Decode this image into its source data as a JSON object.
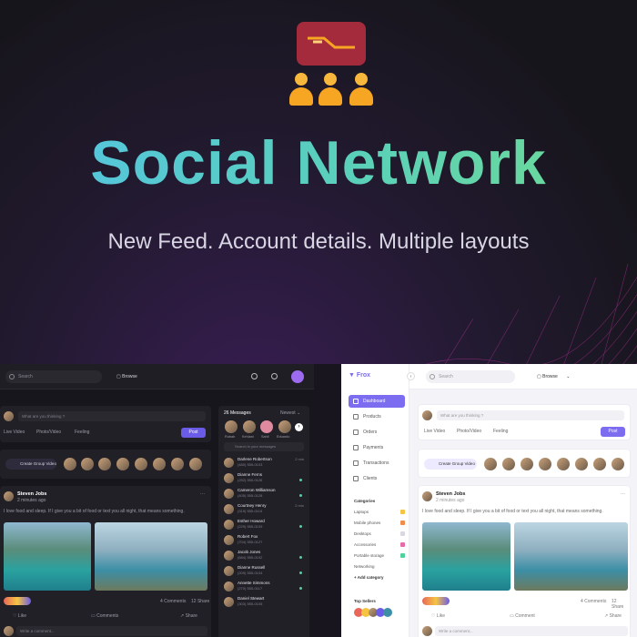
{
  "hero": {
    "title": "Social Network",
    "subtitle": "New Feed. Account details. Multiple layouts",
    "colors": {
      "logo_box": "#a32b3c",
      "people": "#f6a623",
      "title_gradient_start": "#54c3e4",
      "title_gradient_end": "#6fdc93"
    }
  },
  "dark_app": {
    "search_placeholder": "Search",
    "browse_label": "Browse",
    "post_prompt": "What are you thinking ?",
    "post_actions": [
      "Live Video",
      "Photo/Video",
      "Feeling"
    ],
    "post_button": "Post",
    "create_group_video": "Create Group Video",
    "feed_user": "Steven Jobs",
    "feed_time": "2 minutes ago",
    "feed_text": "I love food and sleep. If I give you a bit of food or text you all night, that means something.",
    "feed_stats": {
      "comments": "4 Comments",
      "shares": "12 Share"
    },
    "feed_actions": [
      "Like",
      "Comments",
      "Share"
    ],
    "comment_placeholder": "Write a comment...",
    "messages_header": "26 Messages",
    "messages_filter": "Newest",
    "messages_search": "Search in your messages",
    "story_names": [
      "Rubab",
      "Kehlani",
      "Sahil",
      "Eduardo"
    ],
    "messages": [
      {
        "name": "Darlene Robertson",
        "phone": "(480) 555-0103",
        "time": "2 min"
      },
      {
        "name": "Dianne Ferns",
        "phone": "(252) 555-0126",
        "time": ""
      },
      {
        "name": "Cameron Williamson",
        "phone": "(405) 555-0128",
        "time": ""
      },
      {
        "name": "Courtney Henry",
        "phone": "(319) 555-0115",
        "time": "2 min"
      },
      {
        "name": "Esther Howard",
        "phone": "(229) 555-0109",
        "time": ""
      },
      {
        "name": "Robert Fox",
        "phone": "(704) 555-0127",
        "time": ""
      },
      {
        "name": "Jacob Jones",
        "phone": "(684) 555-0102",
        "time": ""
      },
      {
        "name": "Dianne Russell",
        "phone": "(209) 555-0104",
        "time": ""
      },
      {
        "name": "Annette Simmons",
        "phone": "(270) 555-0117",
        "time": ""
      },
      {
        "name": "Daniel Stewart",
        "phone": "(303) 555-0105",
        "time": ""
      }
    ]
  },
  "light_app": {
    "brand": "Frox",
    "search_placeholder": "Search",
    "browse_label": "Browse",
    "nav": [
      "Dashboard",
      "Products",
      "Orders",
      "Payments",
      "Transactions",
      "Clients"
    ],
    "categories_title": "Categories",
    "categories": [
      {
        "label": "Laptops",
        "color": "#f5c542"
      },
      {
        "label": "Mobile phones",
        "color": "#f28c4a"
      },
      {
        "label": "Desktops",
        "color": "#d8d8e0"
      },
      {
        "label": "Accessories",
        "color": "#e86aa9"
      },
      {
        "label": "Portable storage",
        "color": "#4ed19a"
      },
      {
        "label": "Networking",
        "color": ""
      }
    ],
    "add_category": "Add category",
    "top_sellers": "Top Sellers",
    "post_prompt": "What are you thinking ?",
    "post_actions": [
      "Live Video",
      "Photo/Video",
      "Feeling"
    ],
    "post_button": "Post",
    "create_group_video": "Create Group Video",
    "feed_user": "Steven Jobs",
    "feed_time": "2 minutes ago",
    "feed_text": "I love food and sleep. If I give you a bit of food or text you all night, that means something.",
    "feed_stats": {
      "comments": "4 Comments",
      "shares": "12 Share"
    },
    "feed_actions": [
      "Like",
      "Comment",
      "Share"
    ],
    "comment_placeholder": "Write a comment..."
  }
}
